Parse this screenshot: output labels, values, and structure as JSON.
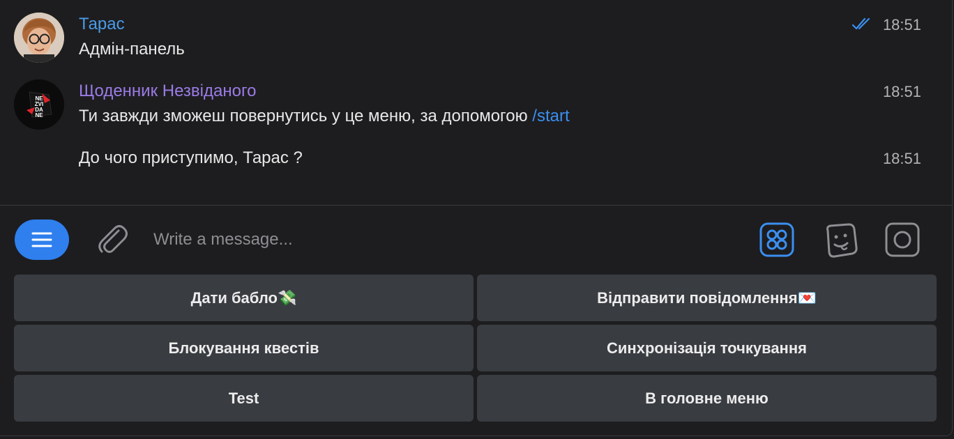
{
  "messages": [
    {
      "sender": "Тарас",
      "sender_color": "#4a9be8",
      "text": "Адмін-панель",
      "time": "18:51",
      "status": "read-double-check"
    },
    {
      "sender": "Щоденник Незвіданого",
      "sender_color": "#9b7be6",
      "avatar_text": [
        "NE",
        "ZVI",
        "DA",
        "NE"
      ],
      "text_before_link": "Ти завжди зможеш повернутись у це меню, за допомогою ",
      "link": "/start",
      "time": "18:51"
    },
    {
      "text": "До чого приступимо, Тарас ?",
      "time": "18:51"
    }
  ],
  "composer": {
    "placeholder": "Write a message...",
    "icons": [
      "menu-icon",
      "paperclip-icon",
      "bot-apps-icon",
      "sticker-icon",
      "camera-record-icon"
    ]
  },
  "keyboard": [
    [
      "Дати бабло💸",
      "Відправити повідомлення💌"
    ],
    [
      "Блокування квестів",
      "Синхронізація точкування"
    ],
    [
      "Test",
      "В головне меню"
    ]
  ],
  "colors": {
    "accent": "#2f7fee",
    "background": "#1d1d1f",
    "button_bg": "#393c41"
  }
}
